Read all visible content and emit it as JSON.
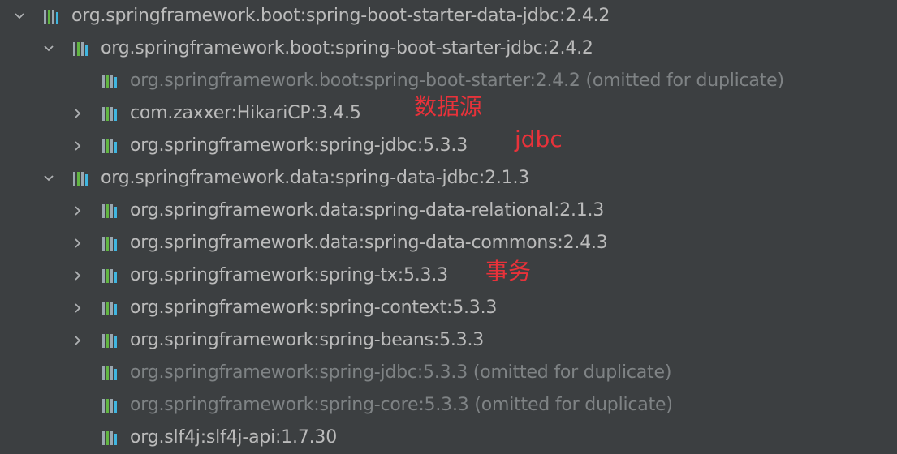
{
  "rows": [
    {
      "label": "org.springframework.boot:spring-boot-starter-data-jdbc:2.4.2",
      "note": "",
      "expanded": true,
      "dim": false
    },
    {
      "label": "org.springframework.boot:spring-boot-starter-jdbc:2.4.2",
      "note": "",
      "expanded": true,
      "dim": false
    },
    {
      "label": "org.springframework.boot:spring-boot-starter:2.4.2",
      "note": "(omitted for duplicate)",
      "expanded": null,
      "dim": true
    },
    {
      "label": "com.zaxxer:HikariCP:3.4.5",
      "note": "",
      "expanded": false,
      "dim": false
    },
    {
      "label": "org.springframework:spring-jdbc:5.3.3",
      "note": "",
      "expanded": false,
      "dim": false
    },
    {
      "label": "org.springframework.data:spring-data-jdbc:2.1.3",
      "note": "",
      "expanded": true,
      "dim": false
    },
    {
      "label": "org.springframework.data:spring-data-relational:2.1.3",
      "note": "",
      "expanded": false,
      "dim": false
    },
    {
      "label": "org.springframework.data:spring-data-commons:2.4.3",
      "note": "",
      "expanded": false,
      "dim": false
    },
    {
      "label": "org.springframework:spring-tx:5.3.3",
      "note": "",
      "expanded": false,
      "dim": false
    },
    {
      "label": "org.springframework:spring-context:5.3.3",
      "note": "",
      "expanded": false,
      "dim": false
    },
    {
      "label": "org.springframework:spring-beans:5.3.3",
      "note": "",
      "expanded": false,
      "dim": false
    },
    {
      "label": "org.springframework:spring-jdbc:5.3.3",
      "note": "(omitted for duplicate)",
      "expanded": null,
      "dim": true
    },
    {
      "label": "org.springframework:spring-core:5.3.3",
      "note": "(omitted for duplicate)",
      "expanded": null,
      "dim": true
    },
    {
      "label": "org.slf4j:slf4j-api:1.7.30",
      "note": "",
      "expanded": null,
      "dim": false
    }
  ],
  "annotations": {
    "datasource": "数据源",
    "jdbc": "jdbc",
    "transaction": "事务"
  },
  "colors": {
    "background": "#3c3f41",
    "text": "#bbbbbb",
    "dim_text": "#7f8385",
    "annotation": "#e8323a",
    "icon_bar_light": "#9aa7b0",
    "icon_bar_green": "#62b543",
    "icon_bar_blue": "#40b6e0"
  },
  "icons": {
    "expanded": "chevron-down-icon",
    "collapsed": "chevron-right-icon",
    "library": "library-icon"
  }
}
